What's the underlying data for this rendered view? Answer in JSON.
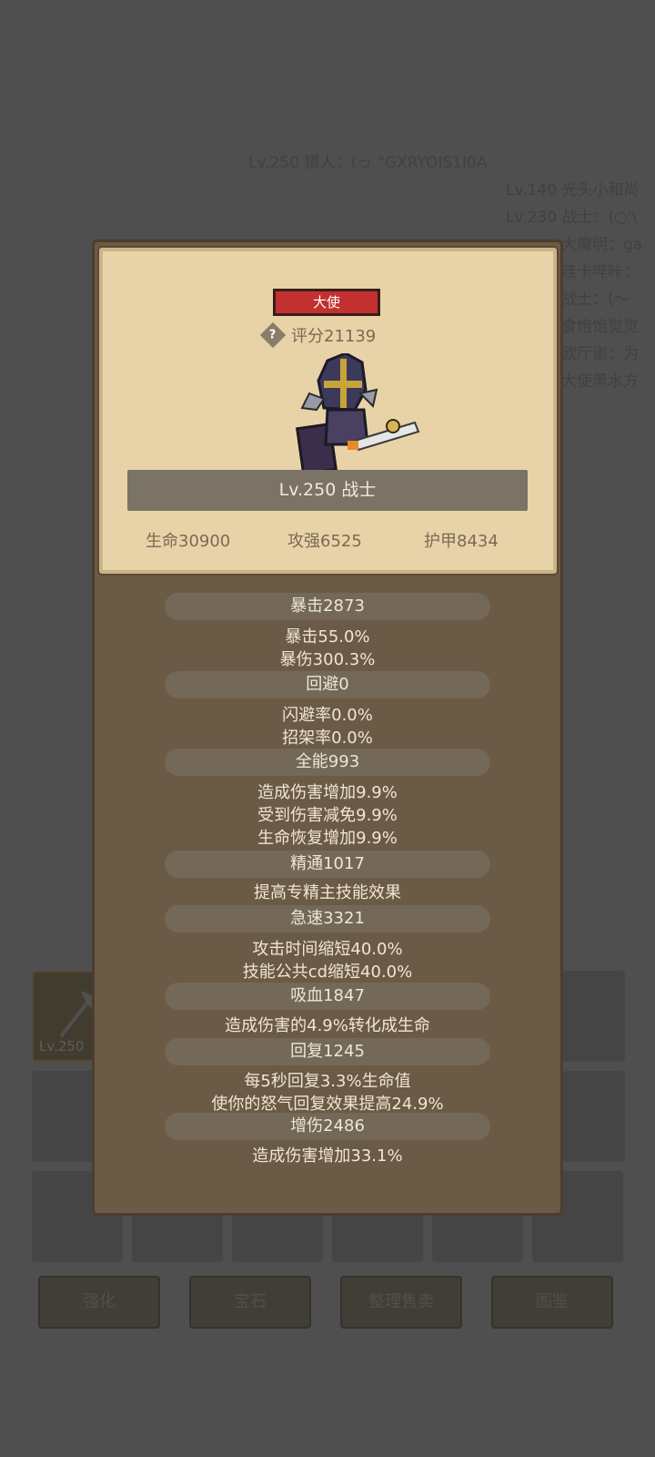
{
  "background": {
    "feed": [
      {
        "text": "Lv.250 猎人：(っ °GXRYOIS1I0A"
      },
      {
        "text": "Lv.140 光头小和尚"
      },
      {
        "text": "Lv.230 战士：(○'\\"
      },
      {
        "text": "大魔明：ga"
      },
      {
        "text": "哇卡哔咔："
      },
      {
        "text": "战士：(～"
      },
      {
        "text": "食饱饱觉觉"
      },
      {
        "text": "欧厅谢：为"
      },
      {
        "text": "大使黑水方"
      }
    ],
    "grid_item_level": "Lv.250",
    "buttons": [
      "强化",
      "宝石",
      "整理售卖",
      "图鉴"
    ]
  },
  "card": {
    "rank": "大使",
    "score": "评分21139",
    "name": "Lv.250 战士",
    "hp": "生命30900",
    "atk": "攻强6525",
    "armor": "护甲8434"
  },
  "sections": [
    {
      "header": "暴击2873",
      "lines": [
        "暴击55.0%",
        "暴伤300.3%"
      ]
    },
    {
      "header": "回避0",
      "lines": [
        "闪避率0.0%",
        "招架率0.0%"
      ]
    },
    {
      "header": "全能993",
      "lines": [
        "造成伤害增加9.9%",
        "受到伤害减免9.9%",
        "生命恢复增加9.9%"
      ]
    },
    {
      "header": "精通1017",
      "lines": [
        "提高专精主技能效果"
      ]
    },
    {
      "header": "急速3321",
      "lines": [
        "攻击时间缩短40.0%",
        "技能公共cd缩短40.0%"
      ]
    },
    {
      "header": "吸血1847",
      "lines": [
        "造成伤害的4.9%转化成生命"
      ]
    },
    {
      "header": "回复1245",
      "lines": [
        "每5秒回复3.3%生命值",
        "使你的怒气回复效果提高24.9%"
      ]
    },
    {
      "header": "增伤2486",
      "lines": [
        "造成伤害增加33.1%"
      ]
    }
  ]
}
